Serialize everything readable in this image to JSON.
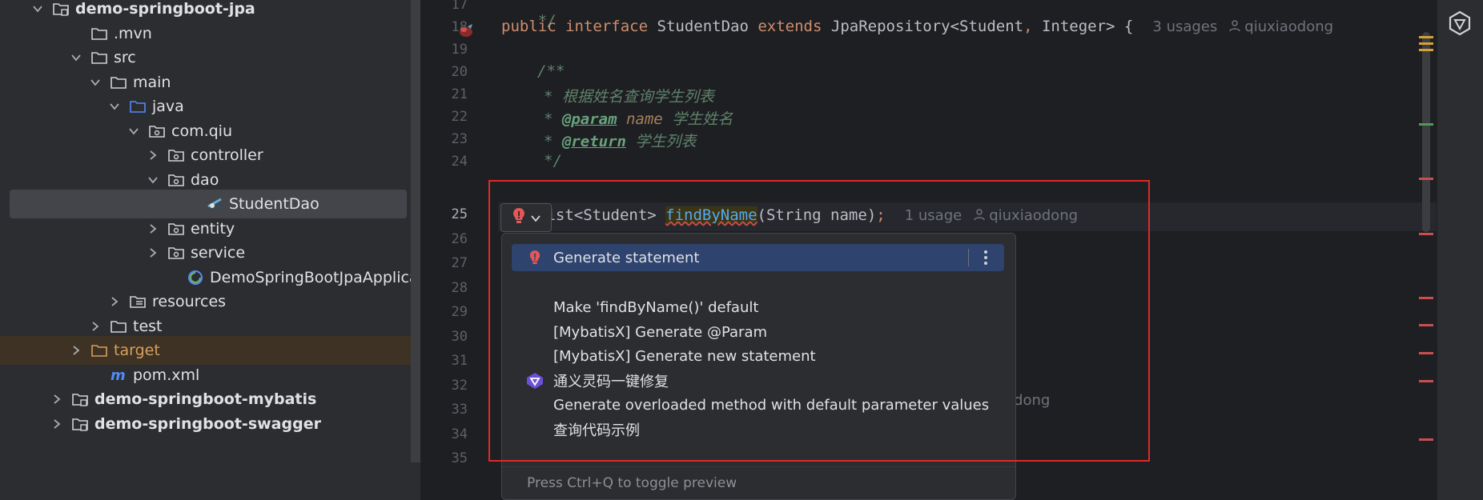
{
  "tree": {
    "items": [
      {
        "label": "demo-springboot-jpa",
        "icon": "module-folder-icon",
        "indent": 0,
        "chevron": "down",
        "bold": true
      },
      {
        "label": ".mvn",
        "icon": "folder-icon",
        "indent": 2,
        "chevron": "none"
      },
      {
        "label": "src",
        "icon": "folder-icon",
        "indent": 2,
        "chevron": "down"
      },
      {
        "label": "main",
        "icon": "folder-icon",
        "indent": 3,
        "chevron": "down"
      },
      {
        "label": "java",
        "icon": "source-folder-icon",
        "indent": 4,
        "chevron": "down"
      },
      {
        "label": "com.qiu",
        "icon": "package-icon",
        "indent": 5,
        "chevron": "down"
      },
      {
        "label": "controller",
        "icon": "package-icon",
        "indent": 6,
        "chevron": "right"
      },
      {
        "label": "dao",
        "icon": "package-icon",
        "indent": 6,
        "chevron": "down"
      },
      {
        "label": "StudentDao",
        "icon": "spring-data-interface-icon",
        "indent": 8,
        "chevron": "none",
        "selected": true
      },
      {
        "label": "entity",
        "icon": "package-icon",
        "indent": 6,
        "chevron": "right"
      },
      {
        "label": "service",
        "icon": "package-icon",
        "indent": 6,
        "chevron": "right"
      },
      {
        "label": "DemoSpringBootJpaApplication",
        "icon": "spring-boot-class-icon",
        "indent": 7,
        "chevron": "none"
      },
      {
        "label": "resources",
        "icon": "resources-folder-icon",
        "indent": 4,
        "chevron": "right"
      },
      {
        "label": "test",
        "icon": "folder-icon",
        "indent": 3,
        "chevron": "right"
      },
      {
        "label": "target",
        "icon": "excluded-folder-icon",
        "indent": 2,
        "chevron": "right",
        "orange": true
      },
      {
        "label": "pom.xml",
        "icon": "maven-icon",
        "indent": 3,
        "chevron": "none"
      },
      {
        "label": "demo-springboot-mybatis",
        "icon": "module-folder-icon",
        "indent": 1,
        "chevron": "right",
        "bold": true
      },
      {
        "label": "demo-springboot-swagger",
        "icon": "module-folder-icon",
        "indent": 1,
        "chevron": "right",
        "bold": true
      }
    ]
  },
  "editor": {
    "line_numbers": [
      "17",
      "18",
      "19",
      "20",
      "21",
      "22",
      "23",
      "24",
      "25",
      "26",
      "27",
      "28",
      "29",
      "30",
      "31",
      "32",
      "33",
      "34",
      "35"
    ],
    "current_line": "25",
    "line17": "*/",
    "line18": {
      "public": "public",
      "interface": "interface",
      "name": "StudentDao",
      "extends": "extends",
      "type": "JpaRepository<Student",
      "comma": ",",
      "type2": " Integer> {",
      "usages": "3 usages",
      "author": "qiuxiaodong"
    },
    "line20": "/**",
    "line21": "* 根据姓名查询学生列表",
    "line22": {
      "star": "* ",
      "tag": "@param",
      "param": "name",
      "desc": " 学生姓名"
    },
    "line23": {
      "star": "* ",
      "tag": "@return",
      "desc": " 学生列表"
    },
    "line24": "*/",
    "line25": {
      "pre": "List<Student> ",
      "method": "findByName",
      "args": "(String name)",
      "semi": ";",
      "usages": "1 usage",
      "author": "qiuxiaodong"
    },
    "hidden_author_fragment": "odong"
  },
  "popup": {
    "items": [
      {
        "label": "Generate statement",
        "icon": "error-bulb-icon",
        "selected": true
      },
      {
        "label": "Make 'findByName()' default",
        "icon": ""
      },
      {
        "label": "[MybatisX] Generate @Param",
        "icon": ""
      },
      {
        "label": "[MybatisX] Generate new statement",
        "icon": ""
      },
      {
        "label": "通义灵码一键修复",
        "icon": "tongyi-lingma-icon"
      },
      {
        "label": "Generate overloaded method with default parameter values",
        "icon": ""
      },
      {
        "label": "查询代码示例",
        "icon": ""
      }
    ],
    "footer": "Press Ctrl+Q to toggle preview"
  },
  "colors": {
    "accent_selection": "#2e436e",
    "error": "#e55757",
    "annotation_box": "#e02828"
  }
}
